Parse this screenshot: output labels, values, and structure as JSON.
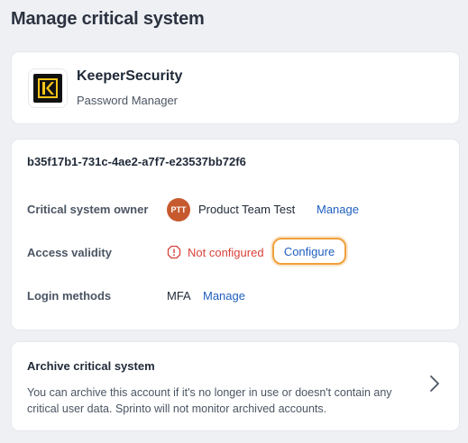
{
  "page": {
    "title": "Manage critical system"
  },
  "app": {
    "name": "KeeperSecurity",
    "category": "Password Manager",
    "logo_icon": "keeper-logo-icon"
  },
  "details": {
    "system_id": "b35f17b1-731c-4ae2-a7f7-e23537bb72f6",
    "owner": {
      "label": "Critical system owner",
      "avatar_initials": "PTT",
      "name": "Product Team Test",
      "action": "Manage"
    },
    "access": {
      "label": "Access validity",
      "status": "Not configured",
      "action": "Configure"
    },
    "login": {
      "label": "Login methods",
      "value": "MFA",
      "action": "Manage"
    }
  },
  "archive": {
    "title": "Archive critical system",
    "description": "You can archive this account if it's no longer in use or doesn't contain any critical user data. Sprinto will not monitor archived accounts."
  },
  "colors": {
    "link": "#1f5fbf",
    "warning": "#d9423a",
    "highlight": "#f0a03c",
    "avatar": "#c65a2e"
  }
}
